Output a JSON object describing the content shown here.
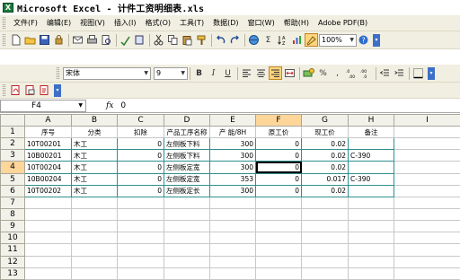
{
  "window": {
    "title": "Microsoft Excel - 计件工资明细表.xls"
  },
  "menu": [
    "文件(F)",
    "编辑(E)",
    "视图(V)",
    "插入(I)",
    "格式(O)",
    "工具(T)",
    "数据(D)",
    "窗口(W)",
    "帮助(H)",
    "Adobe PDF(B)"
  ],
  "toolbar": {
    "zoom": "100%",
    "sigma": "Σ"
  },
  "format_toolbar": {
    "font": "宋体",
    "size": "9",
    "bold": "B",
    "italic": "I",
    "underline": "U",
    "percent": "%",
    "comma": ","
  },
  "formula_bar": {
    "cell": "F4",
    "fx": "fx",
    "value": "0"
  },
  "columns": [
    "A",
    "B",
    "C",
    "D",
    "E",
    "F",
    "G",
    "H",
    "I"
  ],
  "rows": [
    {
      "n": "1",
      "c": [
        "序号",
        "分类",
        "扣除",
        "产品工序名称",
        "产 能/8H",
        "原工价",
        "现工价",
        "备注",
        ""
      ]
    },
    {
      "n": "2",
      "c": [
        "10T00201",
        "木工",
        "0",
        "左侧板下料",
        "300",
        "0",
        "0.02",
        "",
        ""
      ]
    },
    {
      "n": "3",
      "c": [
        "10B00201",
        "木工",
        "0",
        "左侧板下料",
        "300",
        "0",
        "0.02",
        "C-390",
        ""
      ]
    },
    {
      "n": "4",
      "c": [
        "10T00204",
        "木工",
        "0",
        "左侧板定宽",
        "300",
        "0",
        "0.02",
        "",
        ""
      ]
    },
    {
      "n": "5",
      "c": [
        "10B00204",
        "木工",
        "0",
        "左侧板定宽",
        "353",
        "0",
        "0.017",
        "C-390",
        ""
      ]
    },
    {
      "n": "6",
      "c": [
        "10T00202",
        "木工",
        "0",
        "左侧板定长",
        "300",
        "0",
        "0.02",
        "",
        ""
      ]
    },
    {
      "n": "7",
      "c": [
        "",
        "",
        "",
        "",
        "",
        "",
        "",
        "",
        ""
      ]
    },
    {
      "n": "8",
      "c": [
        "",
        "",
        "",
        "",
        "",
        "",
        "",
        "",
        ""
      ]
    },
    {
      "n": "9",
      "c": [
        "",
        "",
        "",
        "",
        "",
        "",
        "",
        "",
        ""
      ]
    },
    {
      "n": "10",
      "c": [
        "",
        "",
        "",
        "",
        "",
        "",
        "",
        "",
        ""
      ]
    },
    {
      "n": "11",
      "c": [
        "",
        "",
        "",
        "",
        "",
        "",
        "",
        "",
        ""
      ]
    },
    {
      "n": "12",
      "c": [
        "",
        "",
        "",
        "",
        "",
        "",
        "",
        "",
        ""
      ]
    },
    {
      "n": "13",
      "c": [
        "",
        "",
        "",
        "",
        "",
        "",
        "",
        "",
        ""
      ]
    }
  ]
}
